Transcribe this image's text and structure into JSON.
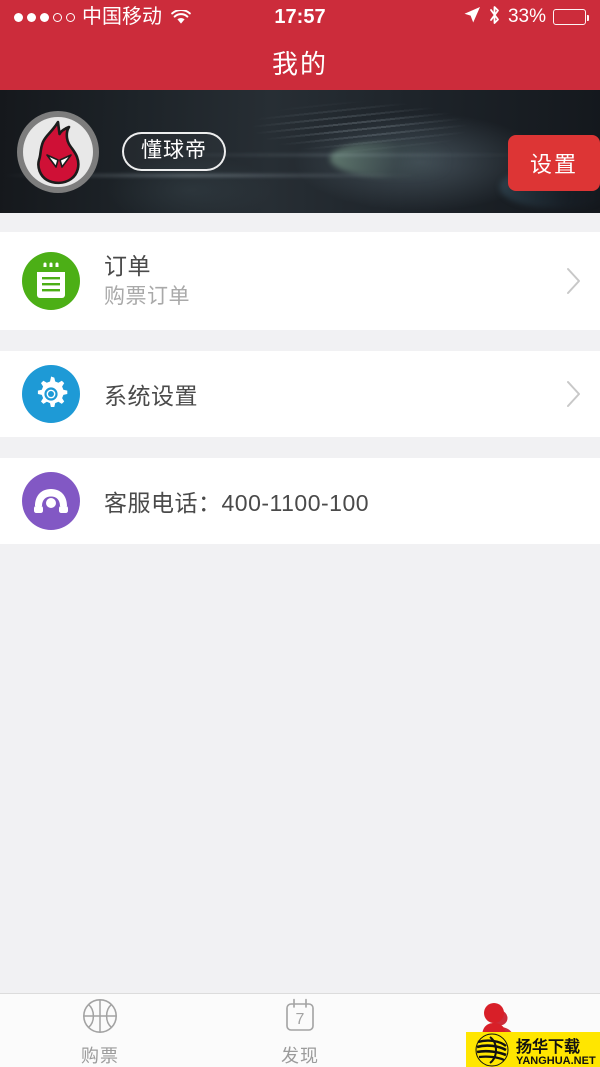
{
  "status_bar": {
    "signal_dots_filled": 3,
    "signal_dots_empty": 2,
    "carrier": "中国移动",
    "wifi_icon": "wifi-icon",
    "time": "17:57",
    "location_icon": "location-arrow-icon",
    "bluetooth_icon": "bluetooth-icon",
    "battery_percent": "33%",
    "battery_level": 33
  },
  "nav_bar": {
    "title": "我的"
  },
  "profile": {
    "avatar_icon": "flame-mascot-avatar",
    "username": "懂球帝",
    "settings_button": "设置",
    "settings_button_color": "#dd3535"
  },
  "menu": {
    "groups": [
      {
        "rows": [
          {
            "icon": "order-notepad-icon",
            "icon_color": "#4caf16",
            "title": "订单",
            "subtitle": "购票订单",
            "chevron": true
          }
        ]
      },
      {
        "rows": [
          {
            "icon": "gear-icon",
            "icon_color": "#1e9ad6",
            "title": "系统设置",
            "subtitle": "",
            "chevron": true
          }
        ]
      },
      {
        "rows": [
          {
            "icon": "telephone-icon",
            "icon_color": "#8258c4",
            "title": "客服电话：400-1100-100",
            "subtitle": "",
            "chevron": false
          }
        ]
      }
    ]
  },
  "tab_bar": {
    "tabs": [
      {
        "icon": "basketball-icon",
        "label": "购票",
        "active": false
      },
      {
        "icon": "calendar-icon",
        "label": "发现",
        "calendar_day": "7",
        "active": false
      },
      {
        "icon": "person-icon",
        "label": "",
        "active": true
      }
    ]
  },
  "watermark": {
    "title": "扬华下载",
    "url": "YANGHUA.NET",
    "bg_color": "#ffe600"
  }
}
